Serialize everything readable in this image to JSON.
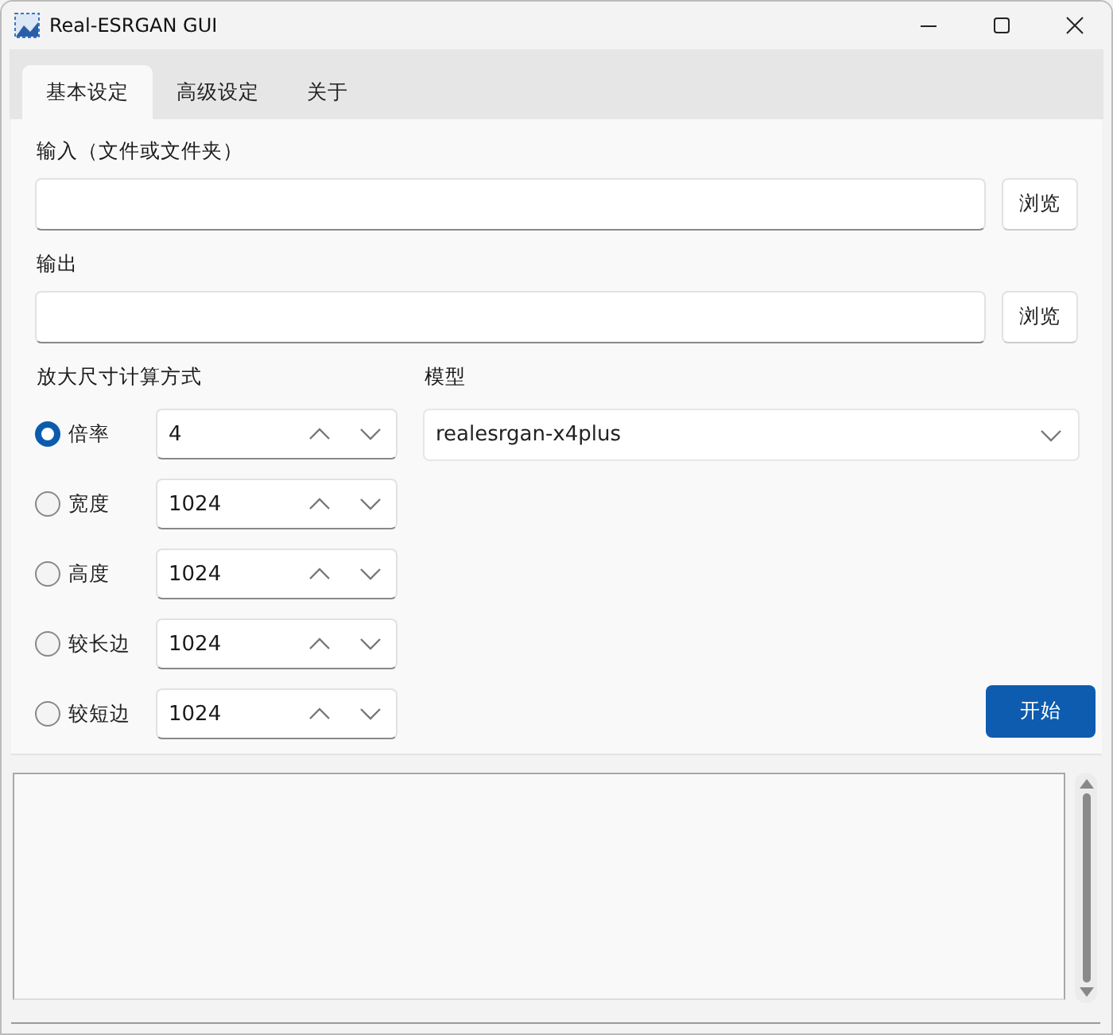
{
  "window": {
    "title": "Real-ESRGAN GUI"
  },
  "tabs": [
    {
      "label": "基本设定",
      "selected": true
    },
    {
      "label": "高级设定",
      "selected": false
    },
    {
      "label": "关于",
      "selected": false
    }
  ],
  "input": {
    "label": "输入（文件或文件夹）",
    "browse": "浏览"
  },
  "output": {
    "label": "输出",
    "browse": "浏览"
  },
  "scale": {
    "label": "放大尺寸计算方式",
    "options": [
      {
        "label": "倍率",
        "value": "4",
        "selected": true
      },
      {
        "label": "宽度",
        "value": "1024",
        "selected": false
      },
      {
        "label": "高度",
        "value": "1024",
        "selected": false
      },
      {
        "label": "较长边",
        "value": "1024",
        "selected": false
      },
      {
        "label": "较短边",
        "value": "1024",
        "selected": false
      }
    ]
  },
  "model": {
    "label": "模型",
    "value": "realesrgan-x4plus"
  },
  "start_button": "开始"
}
